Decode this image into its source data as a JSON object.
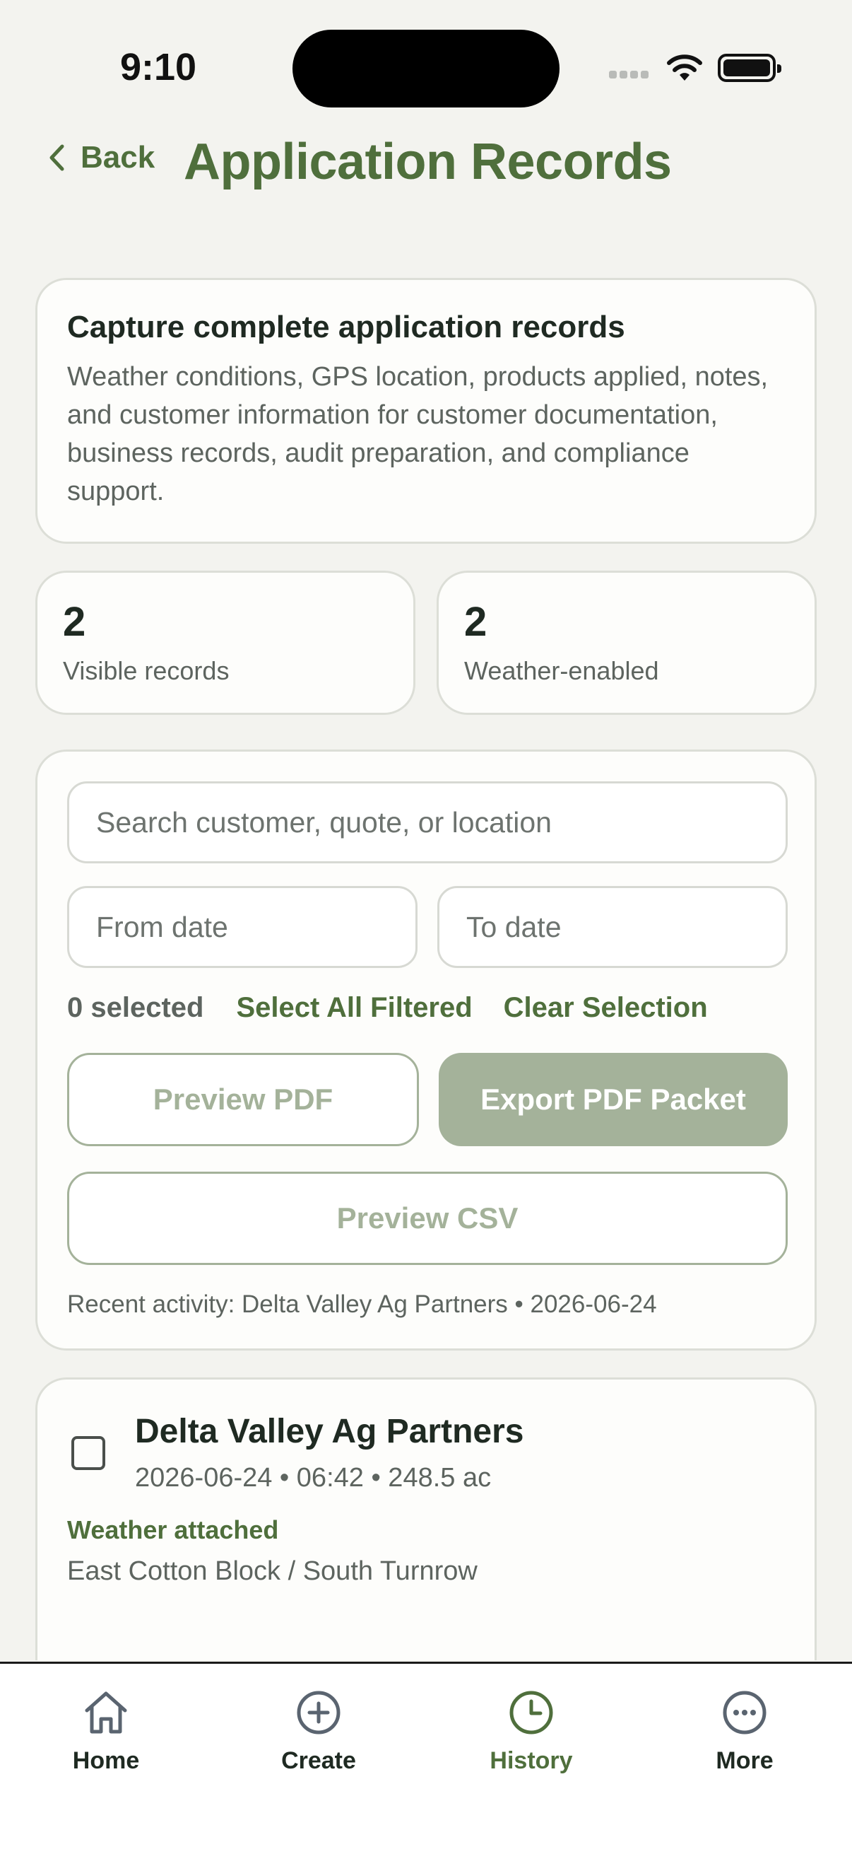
{
  "status": {
    "time": "9:10"
  },
  "header": {
    "back_label": "Back",
    "title": "Application Records"
  },
  "intro": {
    "title": "Capture complete application records",
    "body": "Weather conditions, GPS location, products applied, notes, and customer information for customer documentation, business records, audit preparation, and compliance support."
  },
  "stats": [
    {
      "value": "2",
      "label": "Visible records"
    },
    {
      "value": "2",
      "label": "Weather-enabled"
    }
  ],
  "filters": {
    "search_placeholder": "Search customer, quote, or location",
    "from_placeholder": "From date",
    "to_placeholder": "To date",
    "selected_count": "0 selected",
    "select_all": "Select All Filtered",
    "clear_selection": "Clear Selection",
    "preview_pdf": "Preview PDF",
    "export_pdf": "Export PDF Packet",
    "preview_csv": "Preview CSV",
    "recent_activity": "Recent activity: Delta Valley Ag Partners • 2026-06-24"
  },
  "records": [
    {
      "title": "Delta Valley Ag Partners",
      "meta": "2026-06-24 • 06:42 • 248.5 ac",
      "badge": "Weather attached",
      "location": "East Cotton Block / South Turnrow"
    }
  ],
  "tabs": [
    {
      "label": "Home",
      "icon": "home-icon"
    },
    {
      "label": "Create",
      "icon": "plus-circle-icon"
    },
    {
      "label": "History",
      "icon": "clock-icon",
      "active": true
    },
    {
      "label": "More",
      "icon": "more-icon"
    }
  ],
  "colors": {
    "accent": "#4f6f3c",
    "muted_button": "#a4b29a",
    "background": "#f3f3ef"
  }
}
